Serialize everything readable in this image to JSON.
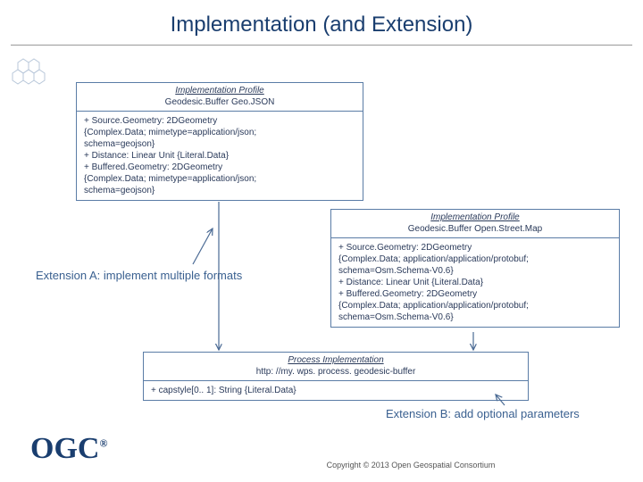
{
  "title": "Implementation (and Extension)",
  "box1": {
    "stereo": "Implementation Profile",
    "name": "Geodesic.Buffer Geo.JSON",
    "body": "+ Source.Geometry: 2DGeometry\n   {Complex.Data; mimetype=application/json;\n   schema=geojson}\n+ Distance: Linear Unit {Literal.Data}\n+ Buffered.Geometry: 2DGeometry\n   {Complex.Data; mimetype=application/json;\n   schema=geojson}"
  },
  "box2": {
    "stereo": "Implementation Profile",
    "name": "Geodesic.Buffer Open.Street.Map",
    "body": "+ Source.Geometry: 2DGeometry\n   {Complex.Data; application/application/protobuf;\n   schema=Osm.Schema-V0.6}\n+ Distance: Linear Unit {Literal.Data}\n+ Buffered.Geometry: 2DGeometry\n   {Complex.Data; application/application/protobuf;\n   schema=Osm.Schema-V0.6}"
  },
  "box3": {
    "stereo": "Process Implementation",
    "name": "http: //my. wps. process. geodesic-buffer",
    "body": "+ capstyle[0.. 1]: String {Literal.Data}"
  },
  "extA": "Extension A: implement multiple formats",
  "extB": "Extension B: add optional parameters",
  "logo": "OGC",
  "reg": "®",
  "copyright": "Copyright © 2013 Open Geospatial Consortium"
}
